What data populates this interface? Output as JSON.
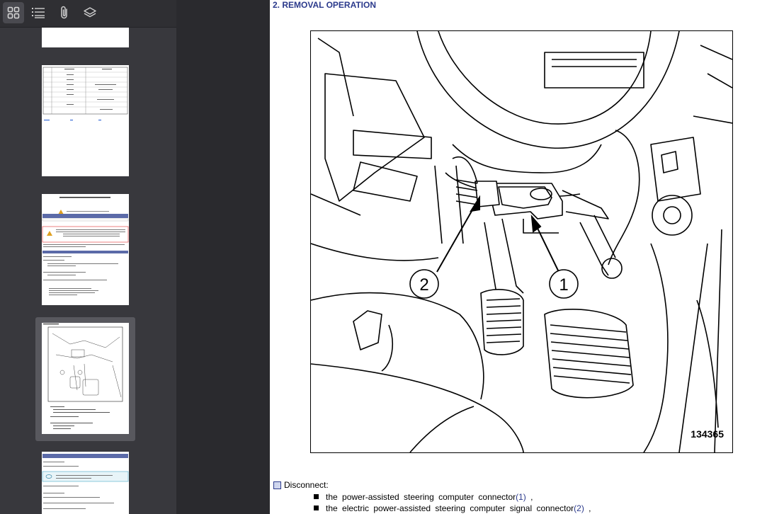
{
  "sidebar": {
    "tools": [
      {
        "icon": "thumbnails-icon",
        "active": true
      },
      {
        "icon": "outline-icon",
        "active": false
      },
      {
        "icon": "attachments-icon",
        "active": false
      },
      {
        "icon": "layers-icon",
        "active": false
      }
    ],
    "thumbnails": [
      {
        "label": "page-thumbnail-1"
      },
      {
        "label": "page-thumbnail-2"
      },
      {
        "label": "page-thumbnail-3"
      },
      {
        "label": "page-thumbnail-4",
        "selected": true
      },
      {
        "label": "page-thumbnail-5"
      }
    ]
  },
  "document": {
    "heading": "2. REMOVAL OPERATION",
    "figure": {
      "callout_1": "1",
      "callout_2": "2",
      "number": "134365"
    },
    "instruction": "Disconnect:",
    "items": [
      {
        "pre": "the power-assisted steering computer connector",
        "ref": "(1)",
        "post": " ,"
      },
      {
        "pre": "the electric power-assisted steering computer signal connector",
        "ref": "(2)",
        "post": " ,"
      }
    ]
  },
  "colors": {
    "sidebar_bg": "#38383d",
    "viewer_bg": "#2a2a2e",
    "heading": "#2b3a8c"
  }
}
